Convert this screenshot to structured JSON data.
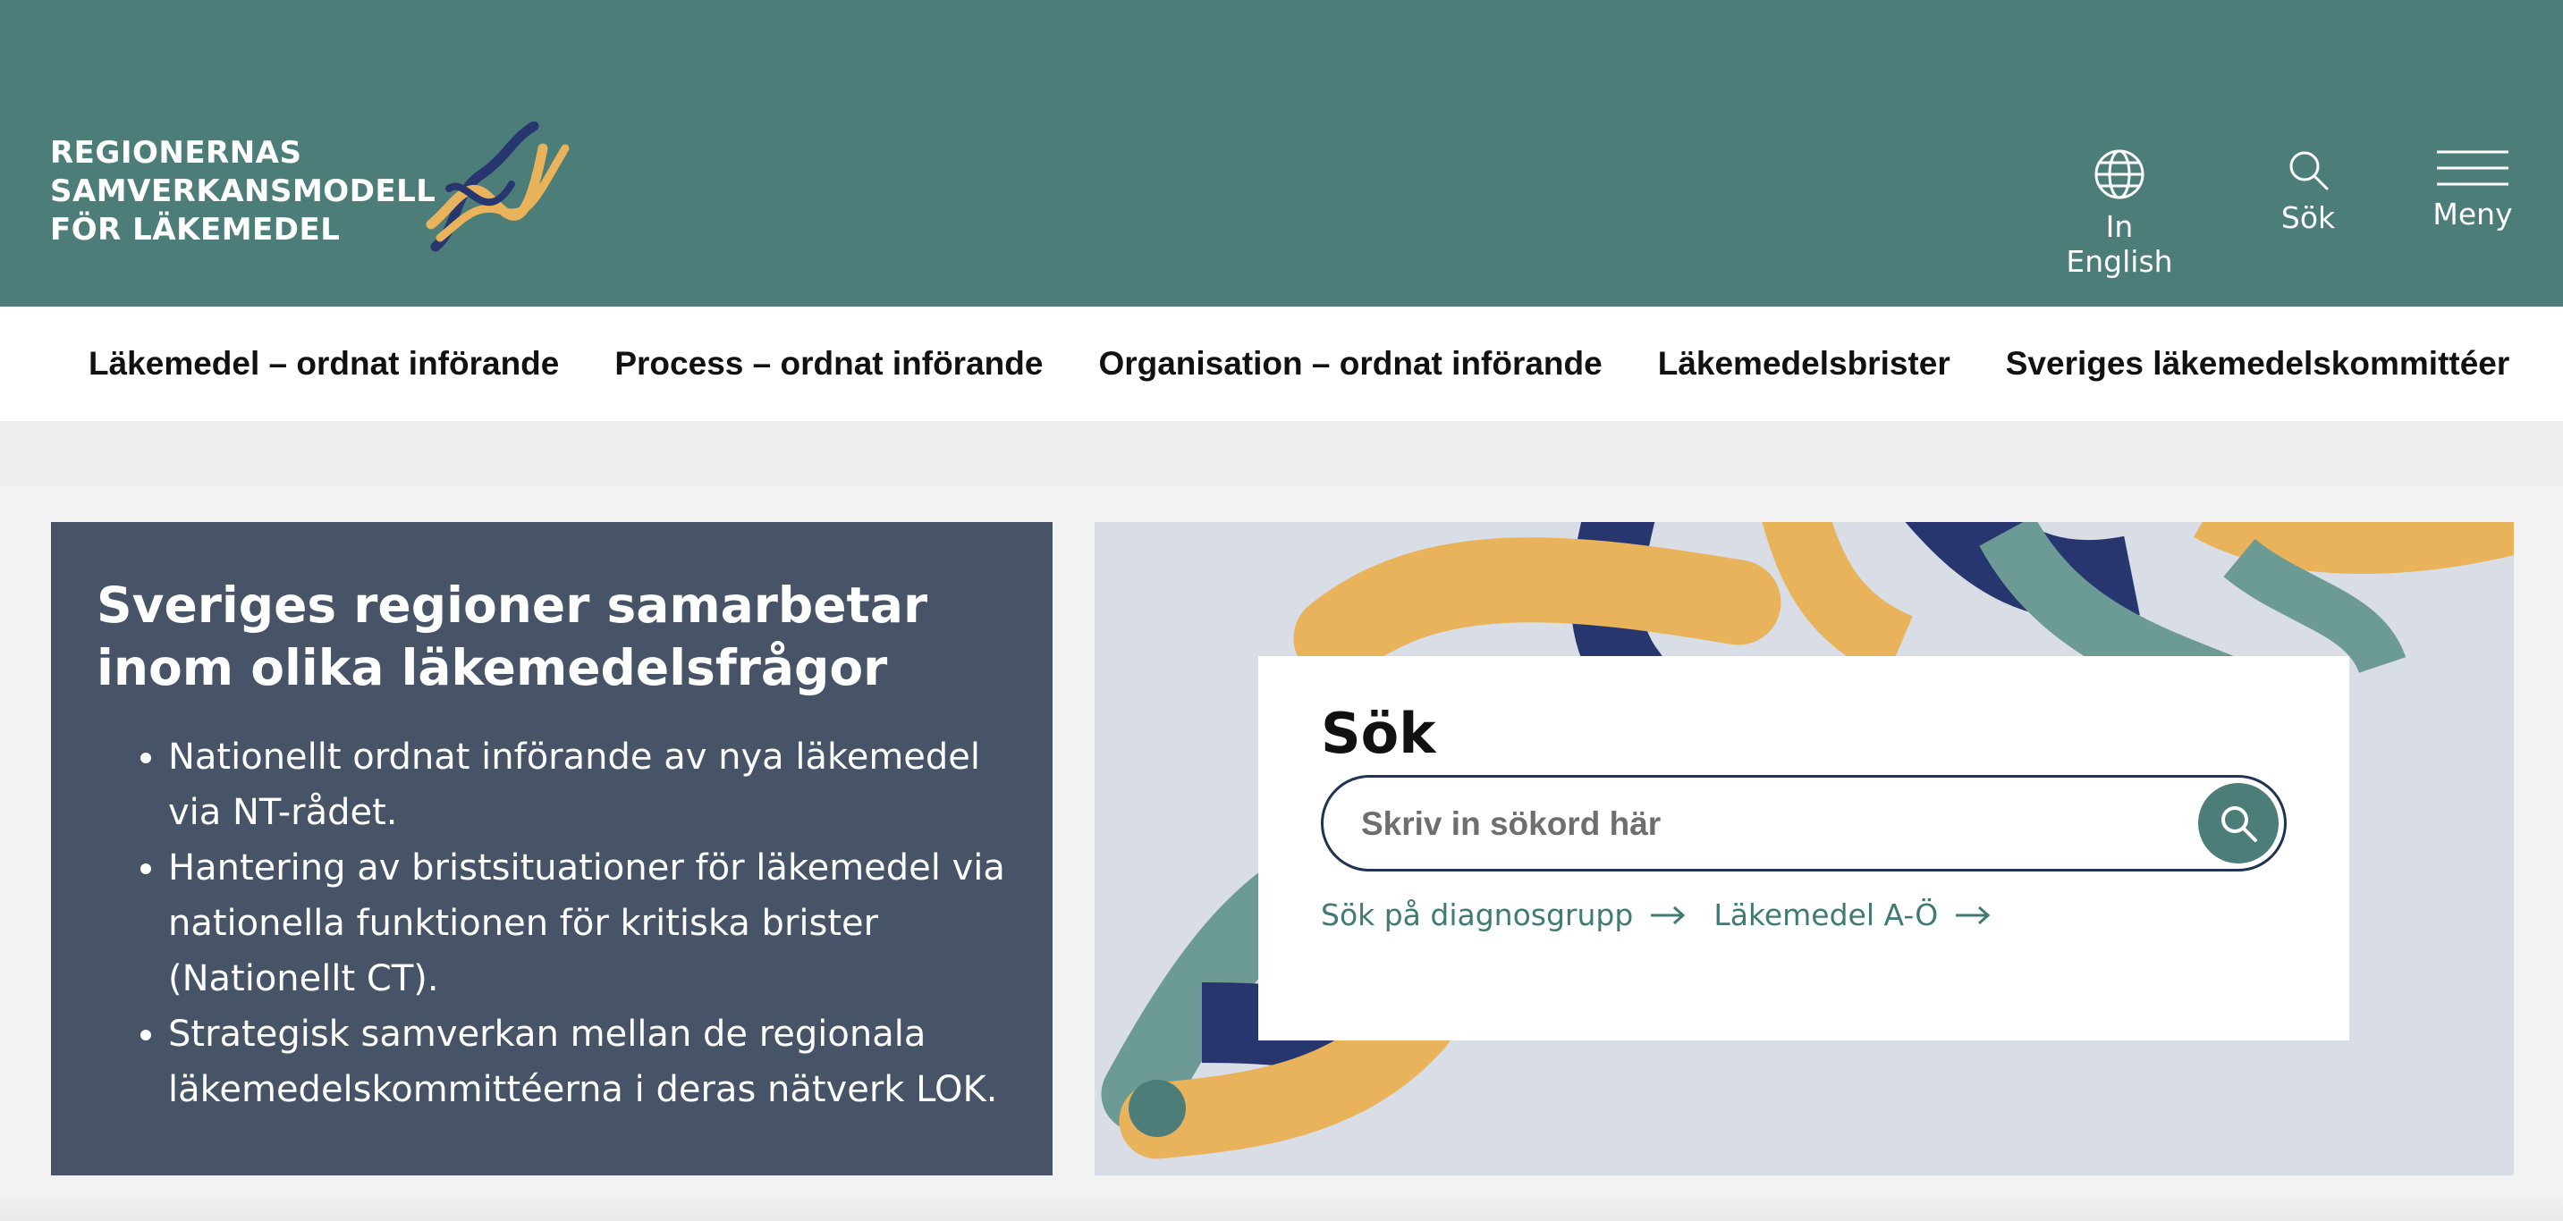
{
  "header": {
    "logo_lines": [
      "REGIONERNAS",
      "SAMVERKANSMODELL",
      "FÖR LÄKEMEDEL"
    ],
    "lang_label": "In English",
    "search_label": "Sök",
    "menu_label": "Meny"
  },
  "nav": {
    "items": [
      "Läkemedel – ordnat införande",
      "Process – ordnat införande",
      "Organisation – ordnat införande",
      "Läkemedelsbrister",
      "Sveriges läkemedelskommittéer"
    ]
  },
  "intro": {
    "title": "Sveriges regioner samarbetar inom olika läkemedelsfrågor",
    "bullets": [
      "Nationellt ordnat införande av nya läkemedel via NT-rådet.",
      "Hantering av bristsituationer för läkemedel via nationella funktionen för kritiska brister (Nationellt CT).",
      "Strategisk samverkan mellan de regionala läkemedelskommittéerna i deras nätverk LOK."
    ]
  },
  "search": {
    "title": "Sök",
    "placeholder": "Skriv in sökord här",
    "link_diagnosis": "Sök på diagnosgrupp",
    "link_atoz": "Läkemedel A-Ö"
  },
  "colors": {
    "header_bg": "#4c7d78",
    "intro_bg": "#475366",
    "hero_bg": "#d8dde6",
    "ribbon_navy": "#283670",
    "ribbon_teal": "#6c9a94",
    "ribbon_yellow": "#e8b35b",
    "link": "#3f7a74"
  }
}
